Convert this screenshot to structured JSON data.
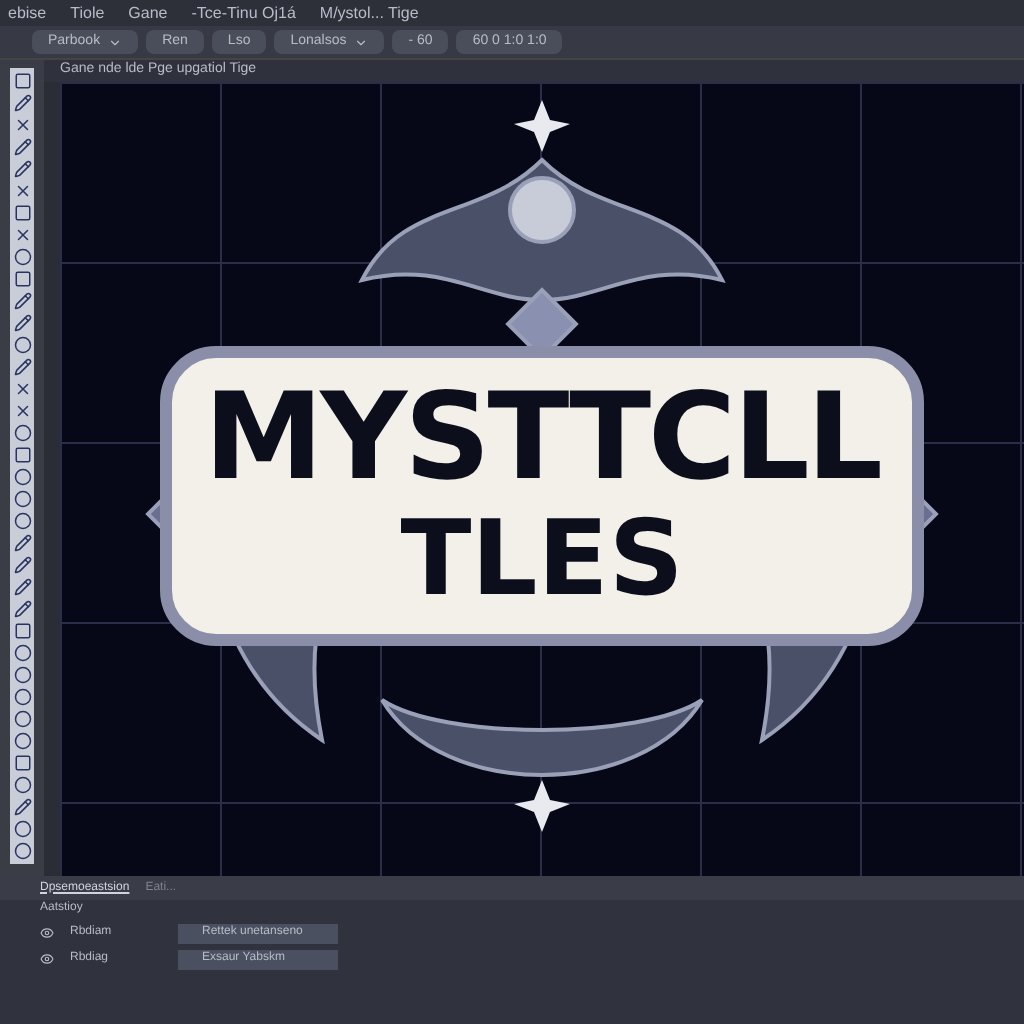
{
  "menu_bar": [
    "ebise",
    "Tiole",
    "Gane",
    "-Tce-Tinu Oj1á",
    "M/ystol... Tige"
  ],
  "toolbar": [
    {
      "label": "Parbook",
      "kind": "dropdown"
    },
    {
      "label": "Ren",
      "kind": "button"
    },
    {
      "label": "Lso",
      "kind": "button"
    },
    {
      "label": "Lonalsos",
      "kind": "dropdown"
    },
    {
      "label": "- 60",
      "kind": "button"
    },
    {
      "label": "60 0 1:0 1:0",
      "kind": "button"
    }
  ],
  "document_tab": {
    "title": "Gane nde lde Pge upgatiol Tige"
  },
  "canvas": {
    "logo": {
      "line_1": "MYSTTCLL",
      "line_2": "TLES"
    }
  },
  "bottom_panel": {
    "tabs": [
      {
        "label": "Dpsemoeastsion",
        "selected": true
      },
      {
        "label": "Eati...",
        "selected": false
      }
    ],
    "header": "Aatstioy",
    "layers": [
      {
        "name": "Rbdiam",
        "clip": "Rettek unetanseno"
      },
      {
        "name": "Rbdiag",
        "clip": "Exsaur Yabskm"
      }
    ]
  }
}
